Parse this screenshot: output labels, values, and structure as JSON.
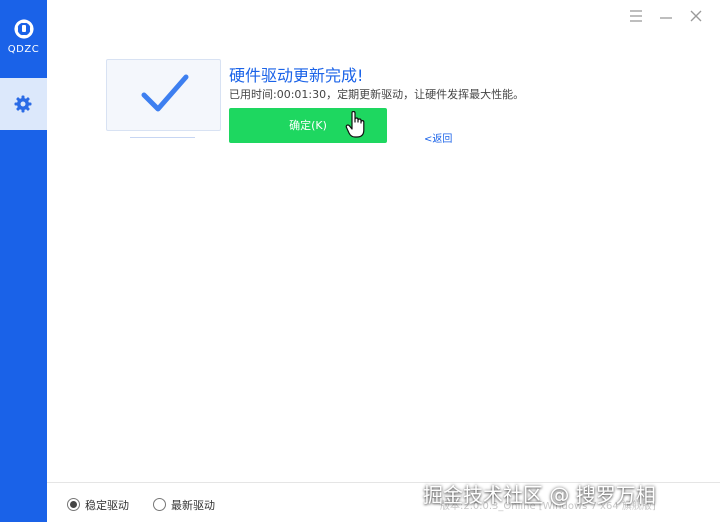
{
  "sidebar": {
    "logo_text": "QDZC",
    "items": [
      {
        "icon": "gear-icon",
        "active": true
      }
    ]
  },
  "window_controls": [
    "menu-icon",
    "minimize-icon",
    "close-icon"
  ],
  "result": {
    "title": "硬件驱动更新完成!",
    "subtitle": "已用时间:00:01:30，定期更新驱动，让硬件发挥最大性能。",
    "confirm_label": "确定(K)",
    "back_label": "<返回"
  },
  "footer": {
    "options": [
      {
        "label": "稳定驱动",
        "selected": true
      },
      {
        "label": "最新驱动",
        "selected": false
      }
    ],
    "version": "版本:2.0.0.3_Online [Windows 7 x64 旗舰版]"
  },
  "watermark": "掘金技术社区 @ 搜罗万相",
  "colors": {
    "sidebar": "#1a62e8",
    "accent": "#1b63e8",
    "confirm": "#1ed760"
  }
}
